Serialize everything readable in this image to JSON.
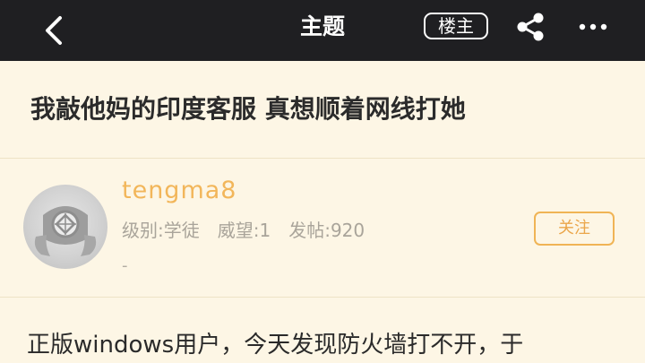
{
  "topbar": {
    "title": "主题",
    "op_label": "楼主",
    "icons": {
      "back": "back-chevron-icon",
      "share": "share-icon",
      "more": "more-dots-icon"
    }
  },
  "post": {
    "title": "我敲他妈的印度客服 真想顺着网线打她",
    "content_preview": "正版windows用户，今天发现防火墙打不开，于"
  },
  "author": {
    "username": "tengma8",
    "level": "级别:学徒",
    "prestige": "威望:1",
    "posts": "发帖:920",
    "signature": "-",
    "follow_label": "关注",
    "avatar_icon": "default-avatar-icon"
  },
  "colors": {
    "topbar_bg": "#1f1f22",
    "page_bg": "#fdf6e5",
    "accent": "#f0b455",
    "meta_text": "#a9a49a"
  }
}
